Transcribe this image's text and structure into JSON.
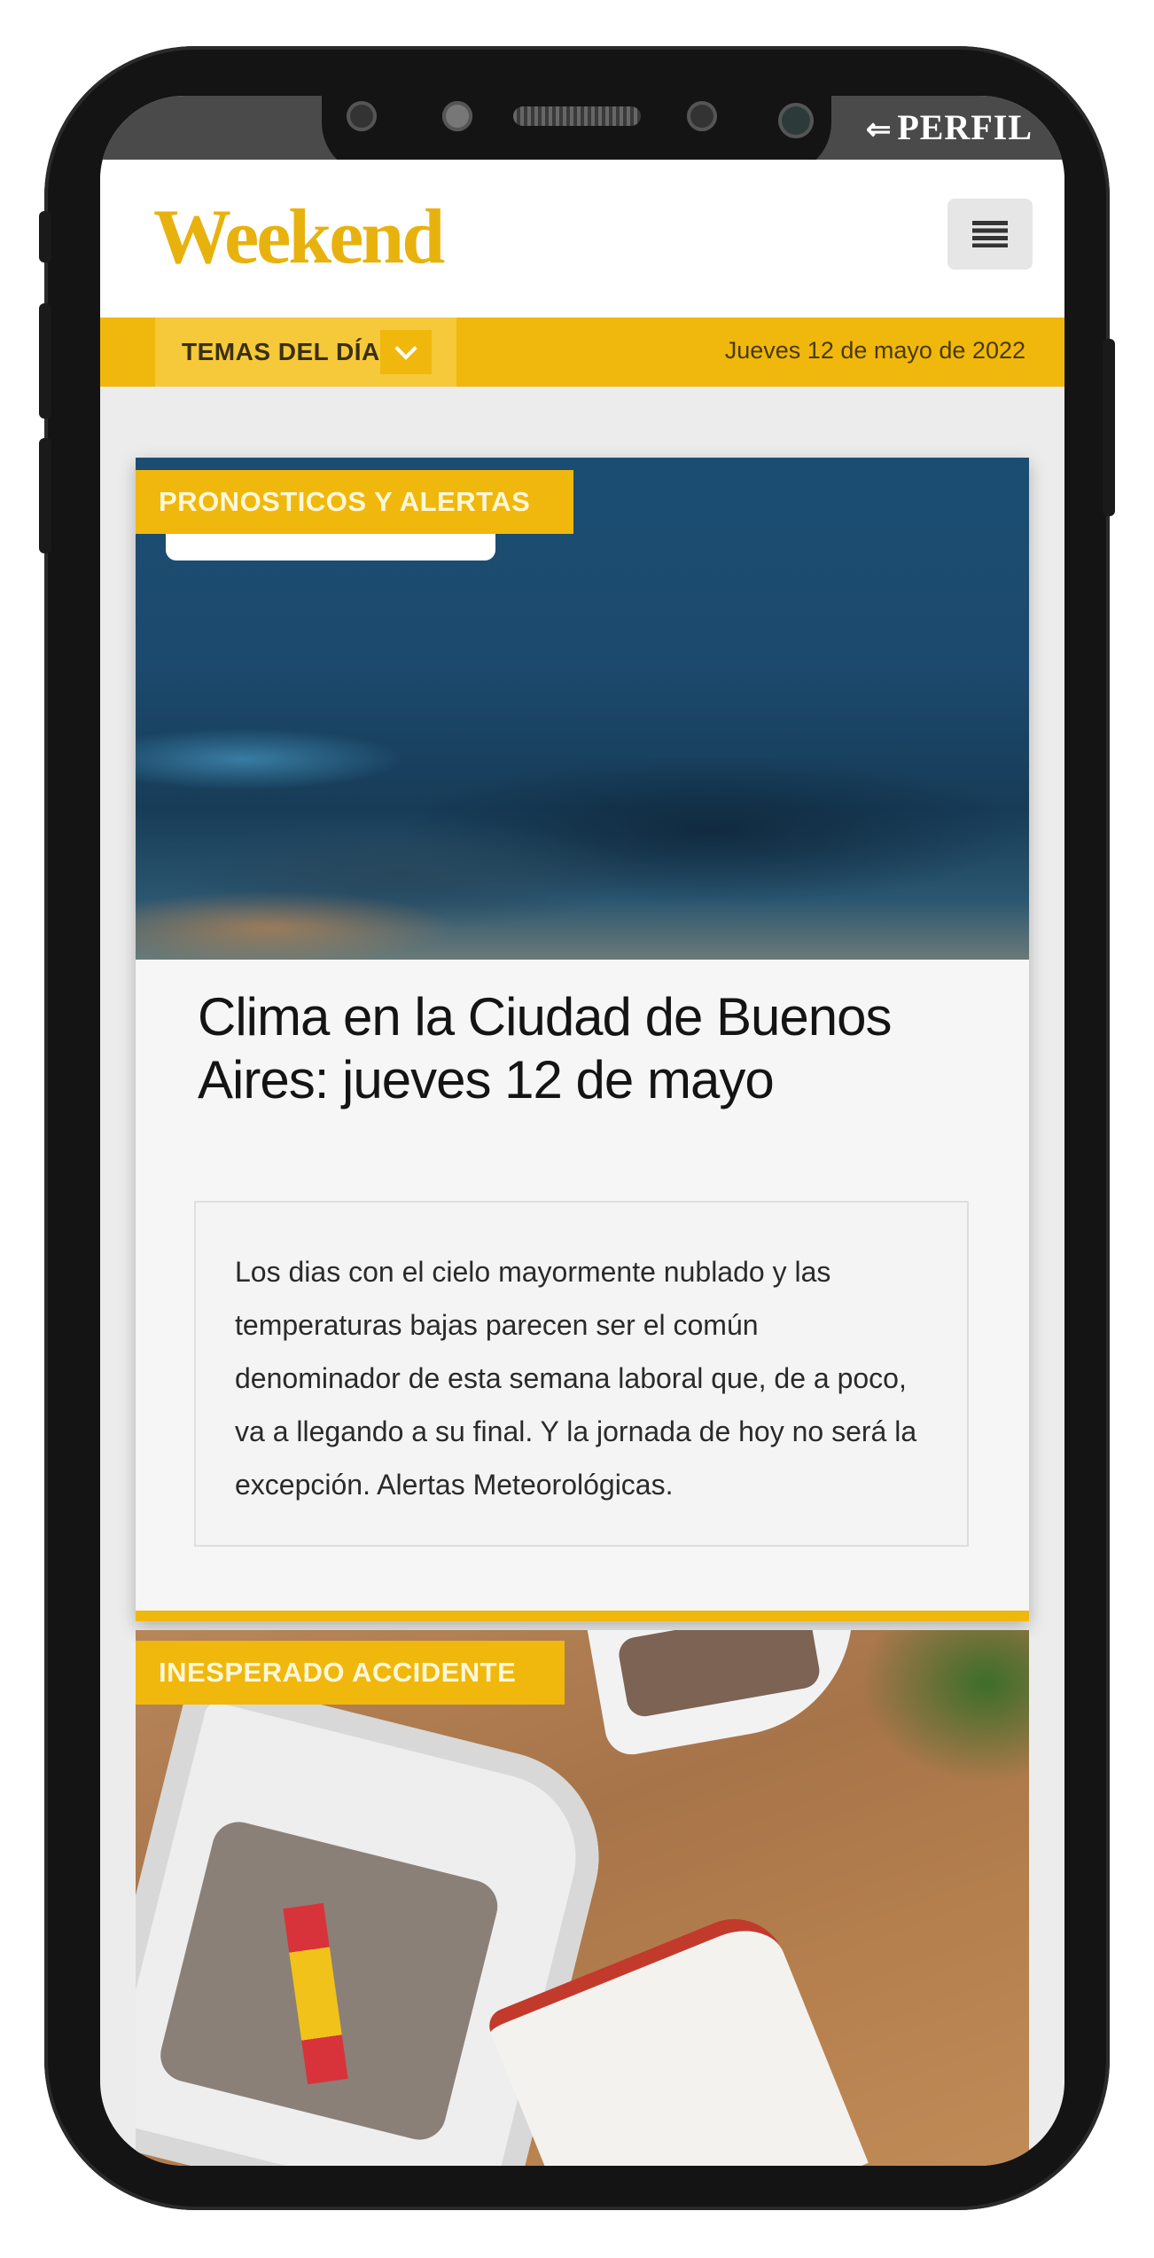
{
  "topbar": {
    "brand": "PERFIL",
    "brand_icon": "arrow-icon"
  },
  "header": {
    "logo": "Weekend",
    "menu_icon": "hamburger-menu-icon"
  },
  "nav": {
    "temas_label": "TEMAS DEL DÍA",
    "date": "Jueves 12 de mayo de 2022"
  },
  "articles": [
    {
      "category": "PRONOSTICOS Y ALERTAS",
      "title": "Clima en la Ciudad de Buenos Aires: jueves 12 de mayo",
      "summary": "Los dias con el cielo mayormente nublado y las temperaturas bajas parecen ser el común denominador de esta semana laboral que, de a poco, va a llegando a su final. Y la jornada de hoy no será la excepción. Alertas Meteorológicas."
    },
    {
      "category": "INESPERADO ACCIDENTE"
    }
  ],
  "colors": {
    "accent": "#f0b80c",
    "logo": "#e8b20e",
    "frame": "#141414"
  }
}
